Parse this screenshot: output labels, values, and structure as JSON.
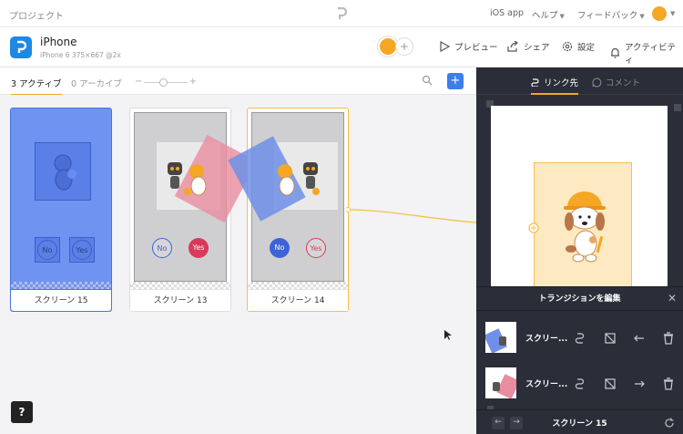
{
  "topbar": {
    "projects": "プロジェクト",
    "nav": [
      "iOS app",
      "ヘルプ",
      "フィードバック"
    ]
  },
  "project": {
    "name": "iPhone",
    "sub": "iPhone 6   375×667 @2x"
  },
  "header_buttons": {
    "preview": "プレビュー",
    "share": "シェア",
    "settings": "設定",
    "activity": "アクティビティ"
  },
  "tabs": {
    "active": "3 アクティブ",
    "archive": "0 アーカイブ"
  },
  "zoom": {
    "minus": "−",
    "plus": "+"
  },
  "add_label": "+",
  "screens": [
    {
      "label": "スクリーン 15",
      "no": "No",
      "yes": "Yes"
    },
    {
      "label": "スクリーン 13",
      "no": "No",
      "yes": "Yes"
    },
    {
      "label": "スクリーン 14",
      "no": "No",
      "yes": "Yes"
    }
  ],
  "help": "?",
  "right_panel": {
    "tab_links": "リンク先",
    "tab_comments": "コメント",
    "transition_title": "トランジションを編集",
    "rows": [
      {
        "name": "スクリー..."
      },
      {
        "name": "スクリー..."
      }
    ],
    "footer_title": "スクリーン 15",
    "prev": "←",
    "next": "→"
  },
  "colors": {
    "accent": "#f5a623",
    "blue": "#3d7eea",
    "panel": "#2b2e38"
  }
}
